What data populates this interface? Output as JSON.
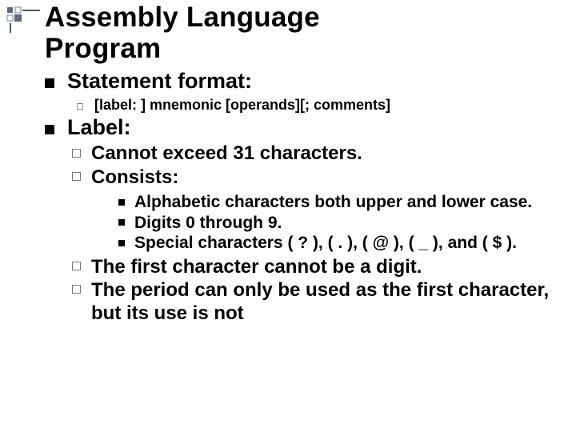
{
  "title_line1": "Assembly Language",
  "title_line2": "Program",
  "sections": {
    "statement": {
      "heading": "Statement format:",
      "item": "[label: ] mnemonic [operands][; comments]"
    },
    "label": {
      "heading": "Label:",
      "cannot": "Cannot exceed 31 characters.",
      "consists_heading": "Consists:",
      "consists": {
        "alpha": "Alphabetic characters both upper and lower case.",
        "digits": "Digits 0 through 9.",
        "special": "Special characters ( ? ), ( . ), ( @ ), ( _ ), and ( $ )."
      },
      "first_char": "The first character cannot be a digit.",
      "period": "The period can only be used as the first character, but its use is not"
    }
  }
}
